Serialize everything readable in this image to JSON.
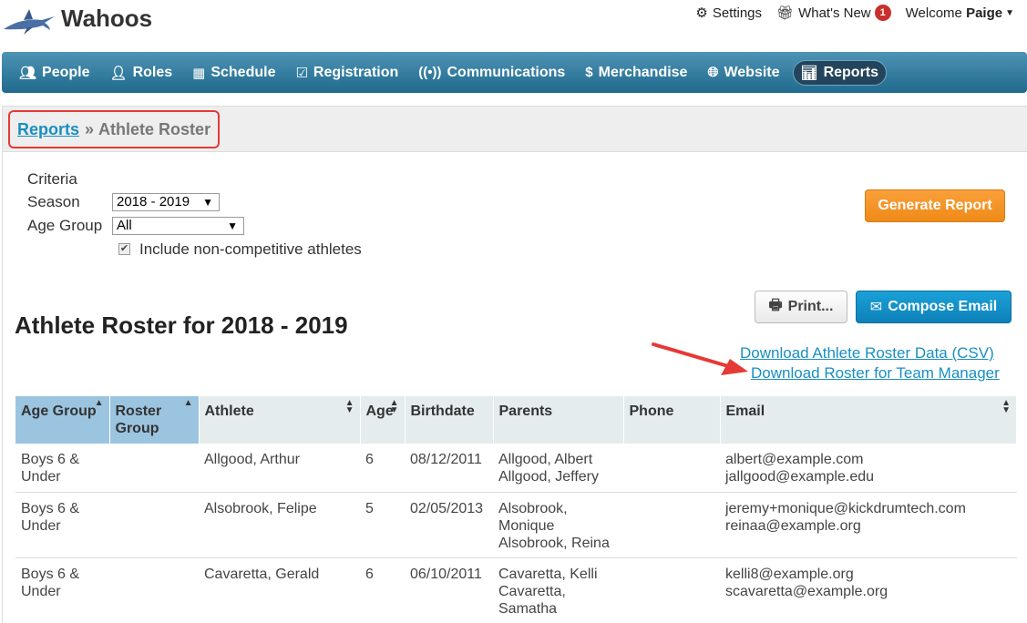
{
  "header": {
    "brand": "Wahoos",
    "settings_label": "Settings",
    "whats_new_label": "What's New",
    "whats_new_count": "1",
    "welcome_prefix": "Welcome",
    "user_name": "Paige"
  },
  "nav": {
    "items": [
      {
        "label": "People",
        "icon": "people-icon"
      },
      {
        "label": "Roles",
        "icon": "user-tie-icon"
      },
      {
        "label": "Schedule",
        "icon": "calendar-icon"
      },
      {
        "label": "Registration",
        "icon": "clipboard-check-icon"
      },
      {
        "label": "Communications",
        "icon": "broadcast-icon"
      },
      {
        "label": "Merchandise",
        "icon": "price-tag-icon"
      },
      {
        "label": "Website",
        "icon": "globe-icon"
      },
      {
        "label": "Reports",
        "icon": "bar-chart-icon",
        "active": true
      }
    ]
  },
  "breadcrumb": {
    "parent": "Reports",
    "separator": "»",
    "current": "Athlete Roster"
  },
  "criteria": {
    "heading": "Criteria",
    "season_label": "Season",
    "season_value": "2018 - 2019",
    "age_group_label": "Age Group",
    "age_group_value": "All",
    "include_noncompetitive_label": "Include non-competitive athletes",
    "include_noncompetitive_checked": true
  },
  "actions": {
    "generate_label": "Generate Report",
    "print_label": "Print...",
    "compose_email_label": "Compose Email",
    "download_csv_label": "Download Athlete Roster Data (CSV)",
    "download_team_manager_label": "Download Roster for Team Manager"
  },
  "roster": {
    "title": "Athlete Roster for 2018 - 2019",
    "columns": [
      "Age Group",
      "Roster Group",
      "Athlete",
      "Age",
      "Birthdate",
      "Parents",
      "Phone",
      "Email"
    ],
    "rows": [
      {
        "age_group": "Boys 6 & Under",
        "roster_group": "",
        "athlete": "Allgood, Arthur",
        "age": "6",
        "birthdate": "08/12/2011",
        "parents": [
          "Allgood, Albert",
          "Allgood, Jeffery"
        ],
        "phone": "",
        "emails": [
          "albert@example.com",
          "jallgood@example.edu"
        ]
      },
      {
        "age_group": "Boys 6 & Under",
        "roster_group": "",
        "athlete": "Alsobrook, Felipe",
        "age": "5",
        "birthdate": "02/05/2013",
        "parents": [
          "Alsobrook, Monique",
          "Alsobrook, Reina"
        ],
        "phone": "",
        "emails": [
          "jeremy+monique@kickdrumtech.com",
          "reinaa@example.org"
        ]
      },
      {
        "age_group": "Boys 6 & Under",
        "roster_group": "",
        "athlete": "Cavaretta, Gerald",
        "age": "6",
        "birthdate": "06/10/2011",
        "parents": [
          "Cavaretta, Kelli",
          "Cavaretta, Samatha"
        ],
        "phone": "",
        "emails": [
          "kelli8@example.org",
          "scavaretta@example.org"
        ]
      }
    ]
  },
  "colors": {
    "nav_top": "#4e93b5",
    "nav_bottom": "#1f6a8d",
    "link": "#1a8fc1",
    "generate": "#ef8a18",
    "compose": "#0d81b8",
    "highlight": "#e53935",
    "sorted_header": "#9bc4e0"
  }
}
